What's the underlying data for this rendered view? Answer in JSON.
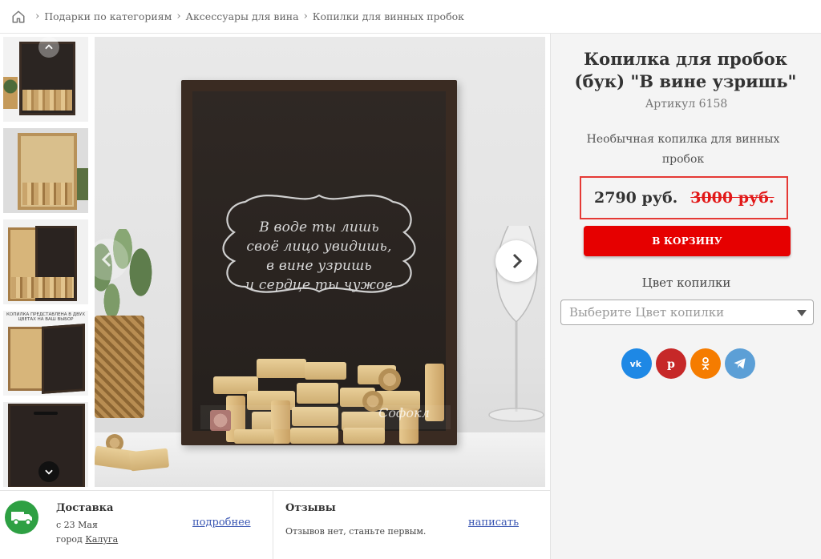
{
  "breadcrumb": {
    "home_icon": "home-icon",
    "items": [
      "Подарки по категориям",
      "Аксессуары для вина",
      "Копилки для винных пробок"
    ]
  },
  "gallery": {
    "thumbnail_caption_4": "КОПИЛКА ПРЕДСТАВЛЕНА В ДВУХ ЦВЕТАХ НА ВАШ ВЫБОР",
    "quote_lines": [
      "В воде ты лишь",
      "своё лицо увидишь,",
      "в вине узришь",
      "и сердце ты чужое"
    ],
    "watermark": "Софокл"
  },
  "product": {
    "title": "Копилка для пробок (бук) \"В вине узришь\"",
    "sku": "Артикул 6158",
    "description": "Необычная копилка для винных пробок",
    "price": "2790 руб.",
    "old_price": "3000 руб.",
    "cart_button": "В КОРЗИНУ",
    "color_label": "Цвет копилки",
    "color_placeholder": "Выберите Цвет копилки"
  },
  "socials": [
    {
      "name": "vk",
      "color": "#1e88e5"
    },
    {
      "name": "pinterest",
      "color": "#c62828"
    },
    {
      "name": "odnoklassniki",
      "color": "#f57c00"
    },
    {
      "name": "telegram",
      "color": "#5c9fd6"
    }
  ],
  "delivery": {
    "title": "Доставка",
    "date": "с 23 Мая",
    "city_prefix": "город",
    "city": "Калуга",
    "more_link": "подробнее"
  },
  "reviews": {
    "title": "Отзывы",
    "text": "Отзывов нет, станьте первым.",
    "write_link": "написать"
  },
  "colors": {
    "accent_red": "#e60000",
    "delivery_green": "#2ea043",
    "link_blue": "#3b57b3"
  }
}
